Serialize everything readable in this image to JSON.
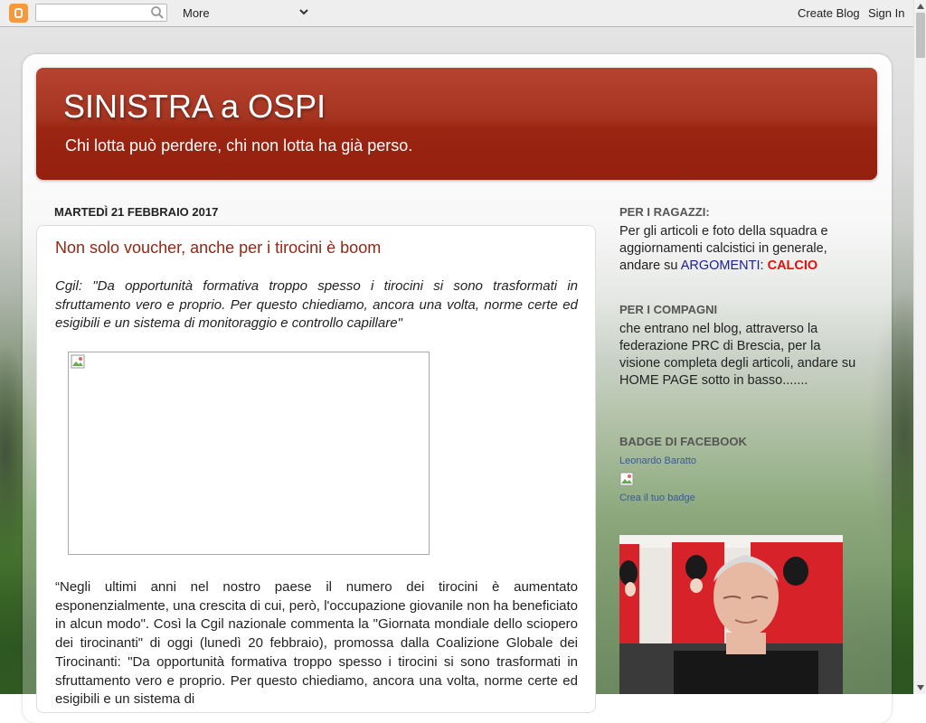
{
  "navbar": {
    "search_placeholder": "",
    "more_label": "More",
    "create_blog_label": "Create Blog",
    "sign_in_label": "Sign In"
  },
  "blog": {
    "title": "SINISTRA a OSPI",
    "description": "Chi lotta può perdere, chi non lotta ha già perso."
  },
  "post": {
    "date": "MARTEDÌ 21 FEBBRAIO 2017",
    "title": "Non solo voucher, anche per i tirocini è boom",
    "intro": "Cgil: \"Da opportunità formativa troppo spesso i tirocini si sono trasformati in sfruttamento vero e proprio. Per questo chiediamo, ancora una volta, norme certe ed esigibili e un sistema di monitoraggio e controllo capillare\"",
    "body": "“Negli ultimi anni nel nostro paese il numero dei tirocini è aumentato esponenzialmente, una crescita di cui, però, l'occupazione giovanile non ha beneficiato in alcun modo\". Così la Cgil nazionale commenta la \"Giornata mondiale dello sciopero dei tirocinanti\" di oggi (lunedì 20 febbraio), promossa dalla Coalizione Globale dei Tirocinanti: \"Da opportunità formativa troppo spesso i tirocini si sono trasformati in sfruttamento vero e proprio. Per questo chiediamo, ancora una volta, norme certe ed esigibili e un sistema di"
  },
  "sidebar": {
    "ragazzi_heading": "PER I RAGAZZI:",
    "ragazzi_text": "Per gli articoli e foto della squadra e aggiornamenti calcistici in generale, andare su",
    "ragazzi_link1": "ARGOMENTI",
    "ragazzi_sep": ":",
    "ragazzi_link2": "CALCIO",
    "compagni_heading": "PER I COMPAGNI",
    "compagni_text": "che entrano nel blog, attraverso la federazione PRC di Brescia, per la visione completa degli articoli, andare su HOME PAGE sotto in basso.......",
    "facebook_heading": "BADGE DI FACEBOOK",
    "facebook_name": "Leonardo Baratto",
    "facebook_create": "Crea il tuo badge"
  },
  "colors": {
    "header_red": "#9a2511",
    "title_red": "#9a2511",
    "link_blue": "#1b1f8c",
    "link_red": "#e01010",
    "facebook_blue": "#3b5998"
  },
  "icons": {
    "blogger_logo": "blogger-icon",
    "search": "search-icon",
    "dropdown": "chevron-down-icon",
    "broken_image": "broken-image-icon"
  }
}
